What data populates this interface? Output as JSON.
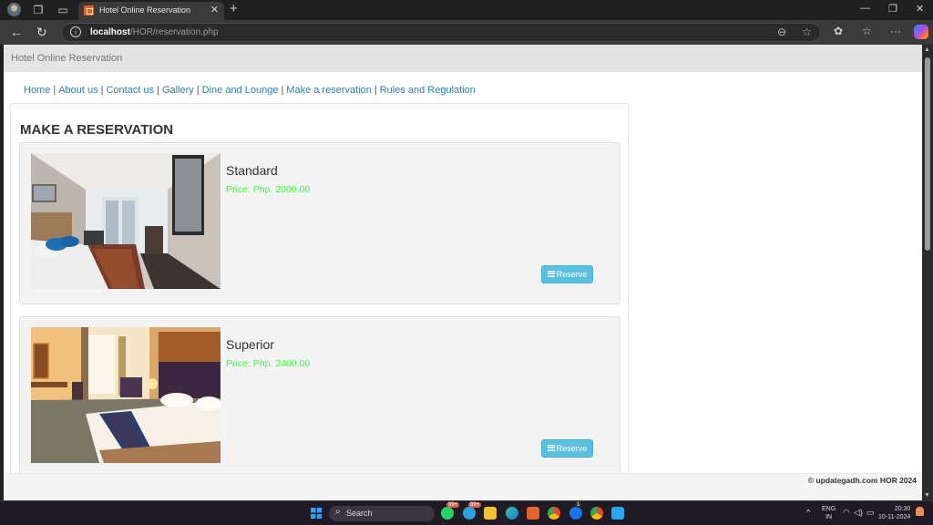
{
  "browser": {
    "tab": {
      "title": "Hotel Online Reservation"
    },
    "url": {
      "host": "localhost",
      "path": "/HOR/reservation.php"
    }
  },
  "site": {
    "title": "Hotel Online Reservation",
    "nav": [
      {
        "label": "Home"
      },
      {
        "label": "About us"
      },
      {
        "label": "Contact us"
      },
      {
        "label": "Gallery"
      },
      {
        "label": "Dine and Lounge"
      },
      {
        "label": "Make a reservation"
      },
      {
        "label": "Rules and Regulation"
      }
    ],
    "nav_separator": "|",
    "heading": "MAKE A RESERVATION",
    "rooms": [
      {
        "name": "Standard",
        "price": "Price: Php. 2000.00",
        "button": "Reserve"
      },
      {
        "name": "Superior",
        "price": "Price: Php. 2400.00",
        "button": "Reserve"
      }
    ],
    "footer": "© updategadh.com HOR 2024",
    "colors": {
      "link": "#337ab7",
      "price": "#33ff33",
      "button": "#5bc0de"
    }
  },
  "taskbar": {
    "search_label": "Search",
    "badges": {
      "whatsapp": "99+",
      "telegram": "99+",
      "chrome_profile_2": "1"
    },
    "language": {
      "line1": "ENG",
      "line2": "IN"
    },
    "time": "20:30",
    "date": "10-11-2024"
  }
}
